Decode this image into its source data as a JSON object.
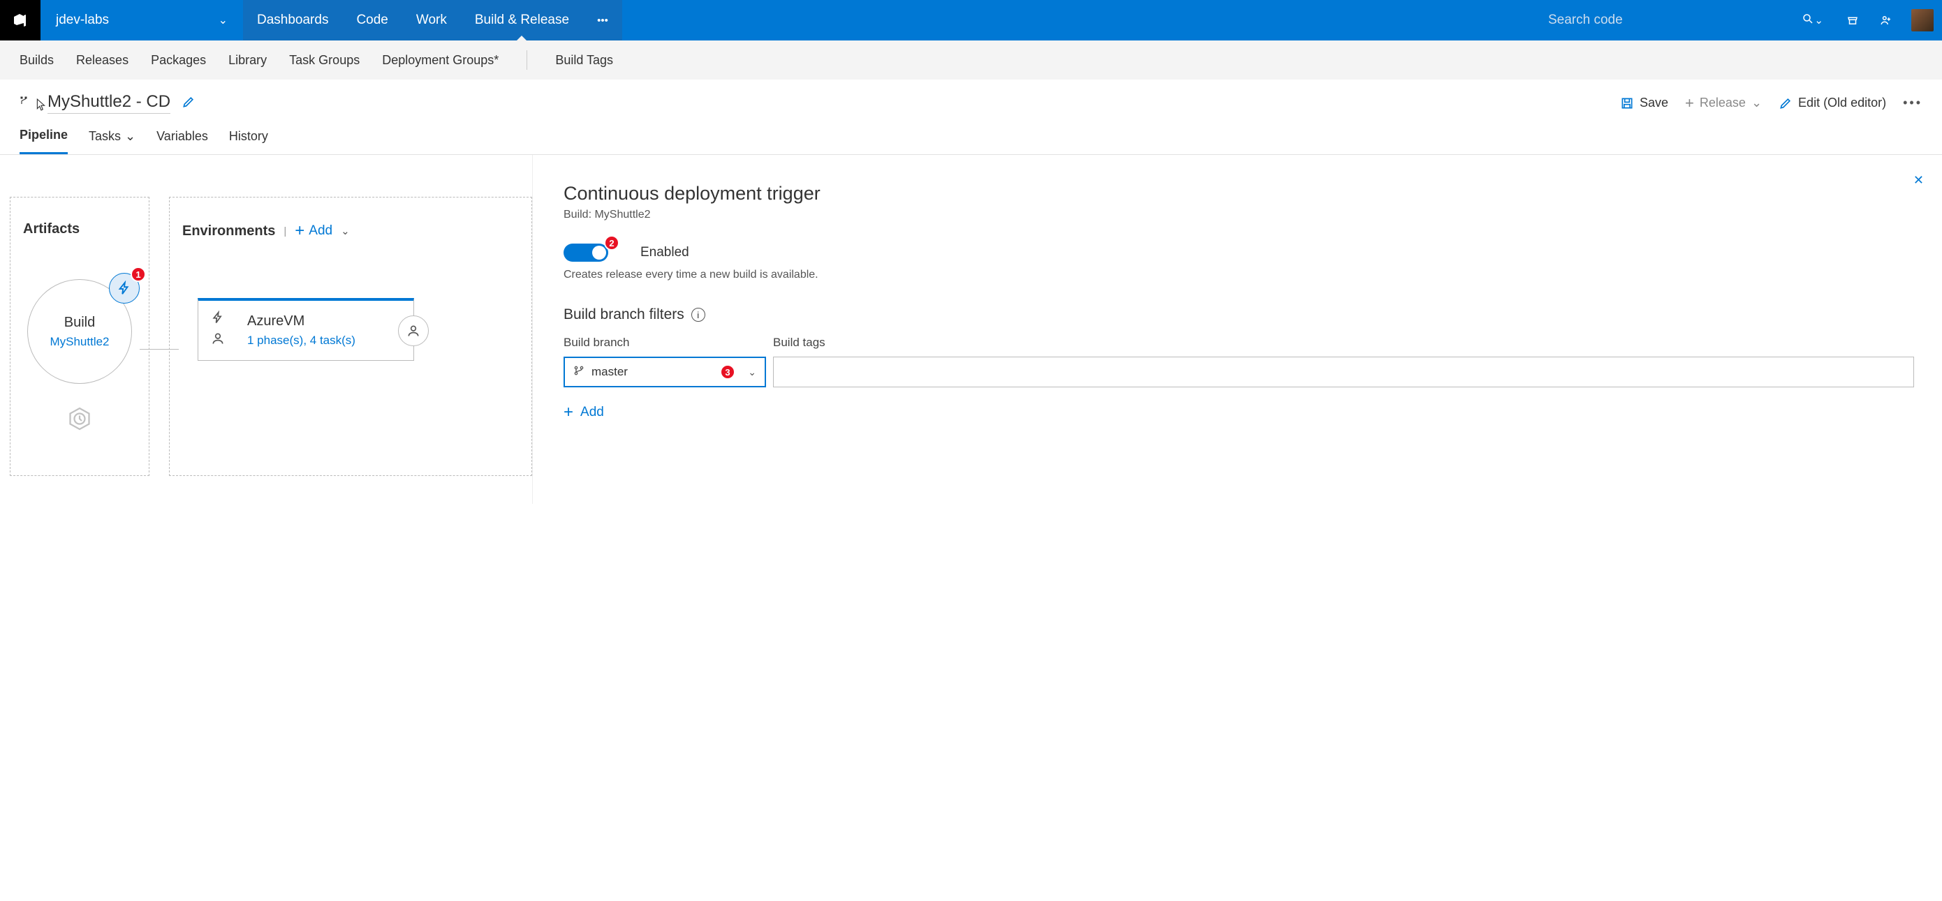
{
  "team": "jdev-labs",
  "topnav": [
    "Dashboards",
    "Code",
    "Work",
    "Build & Release"
  ],
  "topnav_active": 3,
  "search_placeholder": "Search code",
  "subnav": [
    "Builds",
    "Releases",
    "Packages",
    "Library",
    "Task Groups",
    "Deployment Groups*"
  ],
  "subnav_right": [
    "Build Tags"
  ],
  "release_name": "MyShuttle2 - CD",
  "actions": {
    "save": "Save",
    "release": "Release",
    "edit": "Edit (Old editor)"
  },
  "tabs": [
    "Pipeline",
    "Tasks",
    "Variables",
    "History"
  ],
  "tabs_active": 0,
  "artifacts": {
    "title": "Artifacts",
    "node": {
      "type": "Build",
      "name": "MyShuttle2",
      "badge": "1"
    },
    "schedule_icon": "clock-hex-icon"
  },
  "environments": {
    "title": "Environments",
    "add": "Add",
    "card": {
      "name": "AzureVM",
      "detail": "1 phase(s), 4 task(s)"
    }
  },
  "panel": {
    "title": "Continuous deployment trigger",
    "subtitle": "Build: MyShuttle2",
    "toggle_badge": "2",
    "toggle_label": "Enabled",
    "description": "Creates release every time a new build is available.",
    "filters_title": "Build branch filters",
    "branch_label": "Build branch",
    "tags_label": "Build tags",
    "branch_value": "master",
    "branch_badge": "3",
    "add": "Add"
  }
}
